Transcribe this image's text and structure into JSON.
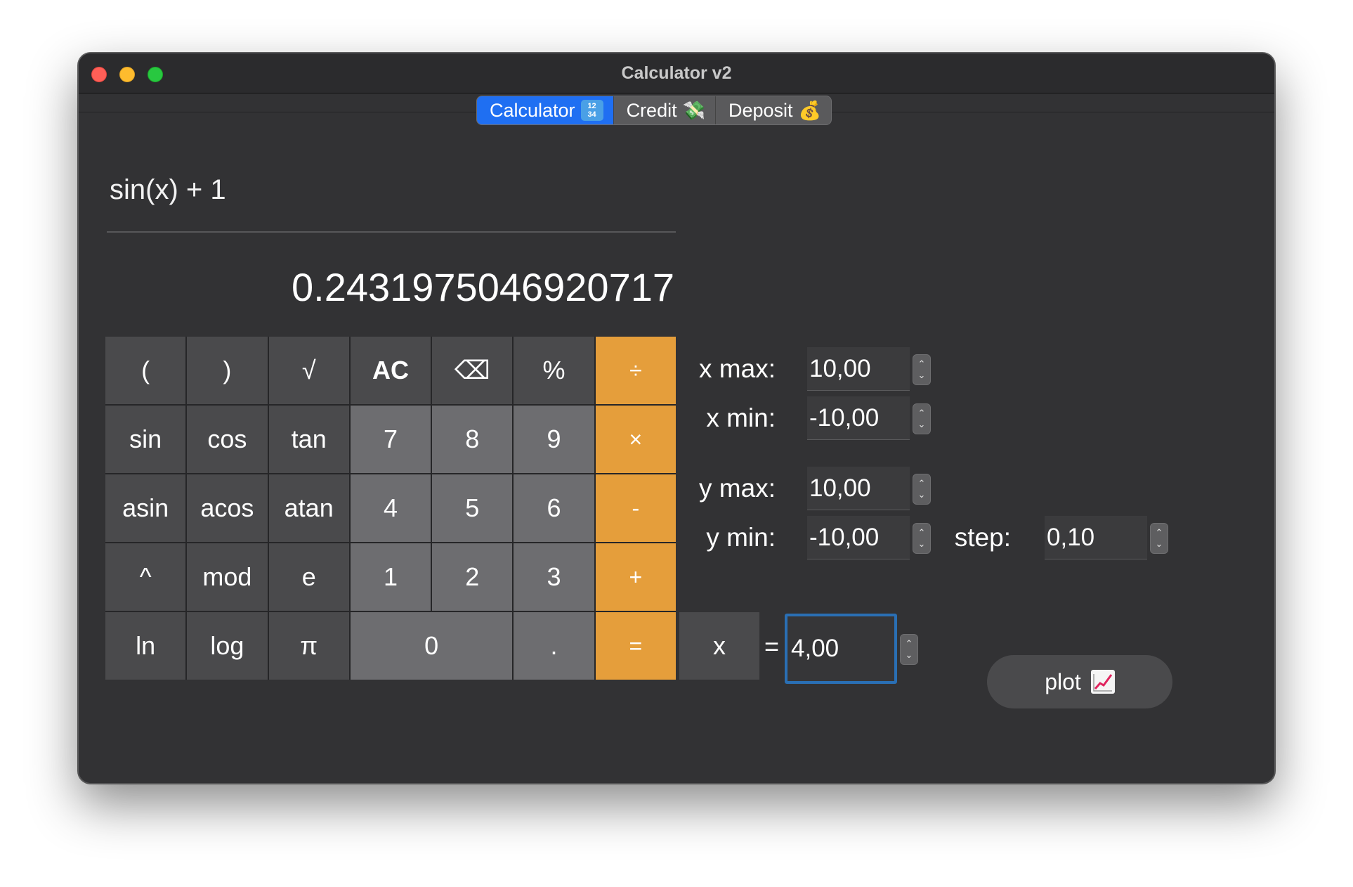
{
  "window": {
    "title": "Calculator v2"
  },
  "tabs": [
    {
      "label": "Calculator",
      "icon": "input-numbers-icon",
      "active": true
    },
    {
      "label": "Credit",
      "icon": "money-with-wings-icon",
      "active": false
    },
    {
      "label": "Deposit",
      "icon": "money-bag-icon",
      "active": false
    }
  ],
  "display": {
    "expression": "sin(x) + 1",
    "result": "0.2431975046920717"
  },
  "keypad": {
    "row1": [
      "(",
      ")",
      "√",
      "AC",
      "⌫",
      "%",
      "÷"
    ],
    "row2": [
      "sin",
      "cos",
      "tan",
      "7",
      "8",
      "9",
      "×"
    ],
    "row3": [
      "asin",
      "acos",
      "atan",
      "4",
      "5",
      "6",
      "-"
    ],
    "row4": [
      "^",
      "mod",
      "e",
      "1",
      "2",
      "3",
      "+"
    ],
    "row5": [
      "ln",
      "log",
      "π",
      "0",
      ".",
      "="
    ]
  },
  "x_variable": {
    "key_label": "x",
    "eq_label": "=",
    "value": "4,00"
  },
  "plot_settings": {
    "x_max": {
      "label": "x max:",
      "value": "10,00"
    },
    "x_min": {
      "label": "x min:",
      "value": "-10,00"
    },
    "y_max": {
      "label": "y max:",
      "value": "10,00"
    },
    "y_min": {
      "label": "y min:",
      "value": "-10,00"
    },
    "step": {
      "label": "step:",
      "value": "0,10"
    }
  },
  "plot_button": {
    "label": "plot",
    "icon": "chart-increasing-icon"
  },
  "colors": {
    "window_bg": "#323234",
    "operator_orange": "#e59e3b",
    "tab_active_blue": "#1f6ff2",
    "focus_ring": "#2a6fb4"
  }
}
